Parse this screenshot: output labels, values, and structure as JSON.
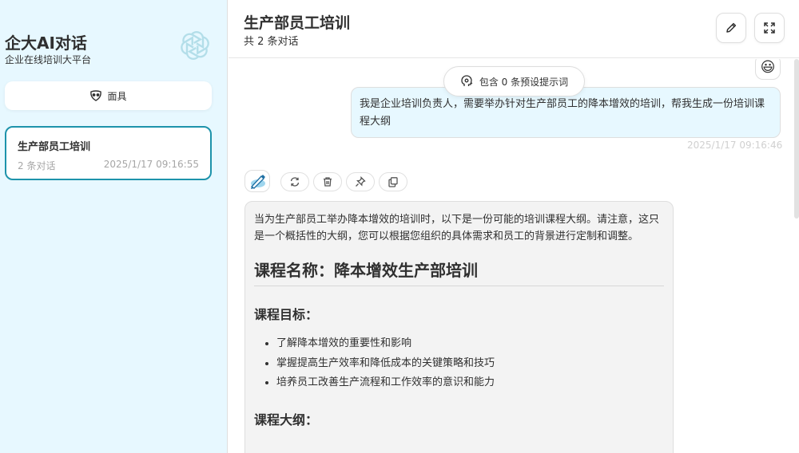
{
  "sidebar": {
    "title": "企大AI对话",
    "subtitle": "企业在线培训大平台",
    "mask_button_label": "面具",
    "chats": [
      {
        "title": "生产部员工培训",
        "count": "2 条对话",
        "time": "2025/1/17 09:16:55"
      }
    ]
  },
  "header": {
    "title": "生产部员工培训",
    "subtitle": "共 2 条对话"
  },
  "chat": {
    "prompt_hint": "包含 0 条预设提示词",
    "user_avatar": "😃",
    "user_message": "我是企业培训负责人，需要举办针对生产部员工的降本增效的培训，帮我生成一份培训课程大纲",
    "user_time": "2025/1/17 09:16:46",
    "bot_intro": "当为生产部员工举办降本增效的培训时，以下是一份可能的培训课程大纲。请注意，这只是一个概括性的大纲，您可以根据您组织的具体需求和员工的背景进行定制和调整。",
    "bot_course_name": "课程名称：降本增效生产部培训",
    "bot_goals_heading": "课程目标：",
    "bot_goals": [
      "了解降本增效的重要性和影响",
      "掌握提高生产效率和降低成本的关键策略和技巧",
      "培养员工改善生产流程和工作效率的意识和能力"
    ],
    "bot_outline_heading": "课程大纲："
  },
  "icons": {
    "brand": "openai-logo-icon",
    "mask": "mask-icon",
    "edit": "edit-icon",
    "fullscreen": "fullscreen-icon",
    "prompt": "brain-icon",
    "bot": "bot-avatar-icon",
    "retry": "retry-icon",
    "delete": "delete-icon",
    "pin": "pin-icon",
    "copy": "copy-icon"
  },
  "colors": {
    "accent": "#1d93ab",
    "sidebar_bg": "#e7f8ff",
    "user_bubble": "#e7f8ff",
    "bot_bubble": "#f3f3f3"
  }
}
